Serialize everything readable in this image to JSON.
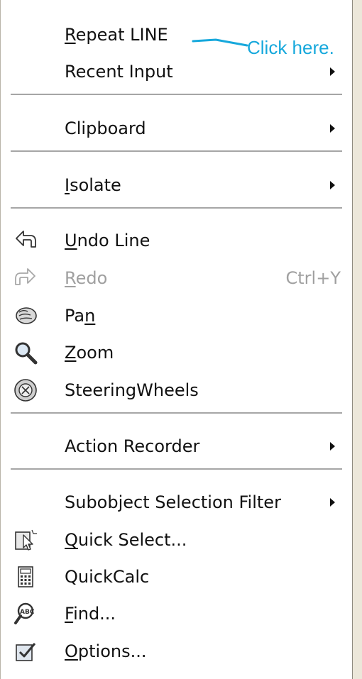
{
  "menu": {
    "items": [
      {
        "label": "Repeat LINE",
        "accel": "R"
      },
      {
        "label": "Recent Input"
      },
      {
        "label": "Clipboard"
      },
      {
        "label": "Isolate",
        "accel": "I"
      },
      {
        "label": "Undo Line",
        "accel": "U",
        "icon": "undo-arrow-icon"
      },
      {
        "label": "Redo",
        "accel": "R",
        "shortcut": "Ctrl+Y",
        "icon": "redo-arrow-icon",
        "disabled": true
      },
      {
        "label": "Pan",
        "accel": "n",
        "icon": "pan-hand-icon"
      },
      {
        "label": "Zoom",
        "accel": "Z",
        "icon": "magnifier-icon"
      },
      {
        "label": "SteeringWheels",
        "icon": "steering-wheel-icon"
      },
      {
        "label": "Action Recorder"
      },
      {
        "label": "Subobject Selection Filter"
      },
      {
        "label": "Quick Select...",
        "accel": "Q",
        "icon": "quick-select-icon"
      },
      {
        "label": "QuickCalc",
        "icon": "calculator-icon"
      },
      {
        "label": "Find...",
        "accel": "F",
        "icon": "find-abc-icon"
      },
      {
        "label": "Options...",
        "accel": "O",
        "icon": "options-check-icon"
      }
    ]
  },
  "callout": {
    "text": "Click here.",
    "color": "#16a8dc"
  }
}
